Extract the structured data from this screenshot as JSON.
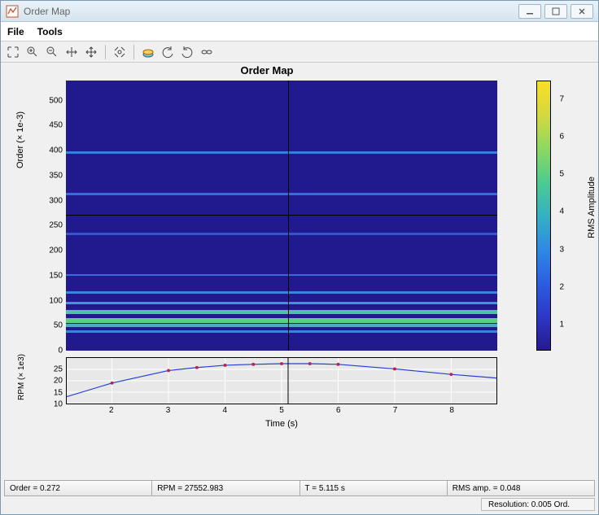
{
  "window": {
    "title": "Order Map"
  },
  "menu": {
    "file": "File",
    "tools": "Tools"
  },
  "toolbar_icons": [
    "expand",
    "zoom-in",
    "zoom-out",
    "zoom-reset",
    "rotate3d",
    "pan",
    "sep",
    "fit",
    "sep",
    "colormap",
    "rewind",
    "step-back",
    "step-fwd",
    "link"
  ],
  "chart_data": {
    "type": "heatmap",
    "title": "Order Map",
    "xlabel": "Time (s)",
    "ylabel": "Order (× 1e-3)",
    "colorbar_label": "RMS Amplitude",
    "xlim": [
      1.2,
      8.8
    ],
    "ylim": [
      0,
      540
    ],
    "yticks": [
      0,
      50,
      100,
      150,
      200,
      250,
      300,
      350,
      400,
      450,
      500
    ],
    "xticks": [
      2,
      3,
      4,
      5,
      6,
      7,
      8
    ],
    "colorbar_range": [
      0.3,
      7.5
    ],
    "colorbar_ticks": [
      1,
      2,
      3,
      4,
      5,
      6,
      7
    ],
    "crosshair": {
      "x": 5.115,
      "y": 272
    },
    "horizontal_bands": [
      {
        "order": 395,
        "intensity": 3.2,
        "color": "#3a7de0"
      },
      {
        "order": 312,
        "intensity": 2.8,
        "color": "#3a6adc"
      },
      {
        "order": 232,
        "intensity": 2.2,
        "color": "#3656d0"
      },
      {
        "order": 150,
        "intensity": 2.5,
        "color": "#3a6adc"
      },
      {
        "order": 115,
        "intensity": 3.0,
        "color": "#3c82e0"
      },
      {
        "order": 95,
        "intensity": 3.5,
        "color": "#3e96d8"
      },
      {
        "order": 78,
        "intensity": 5.0,
        "color": "#4cc4a0"
      },
      {
        "order": 62,
        "intensity": 5.8,
        "color": "#5cd080"
      },
      {
        "order": 50,
        "intensity": 4.2,
        "color": "#44b0c0"
      },
      {
        "order": 38,
        "intensity": 3.0,
        "color": "#3c82e0"
      }
    ],
    "rpm_plot": {
      "ylabel": "RPM (× 1e3)",
      "ylim": [
        10,
        30
      ],
      "yticks": [
        10,
        15,
        20,
        25
      ],
      "x": [
        1.2,
        2.0,
        3.0,
        3.5,
        4.0,
        4.5,
        5.0,
        5.5,
        6.0,
        7.0,
        8.0,
        8.8
      ],
      "y": [
        13,
        19,
        24.5,
        25.8,
        26.8,
        27.2,
        27.5,
        27.5,
        27.2,
        25.2,
        22.8,
        21.2
      ],
      "markers_x": [
        2.0,
        3.0,
        3.5,
        4.0,
        4.5,
        5.0,
        5.5,
        6.0,
        7.0,
        8.0
      ]
    }
  },
  "status": {
    "order_label": "Order = 0.272",
    "rpm_label": "RPM = 27552.983",
    "t_label": "T = 5.115 s",
    "rms_label": "RMS amp. = 0.048"
  },
  "resolution": {
    "label": "Resolution: 0.005 Ord."
  }
}
